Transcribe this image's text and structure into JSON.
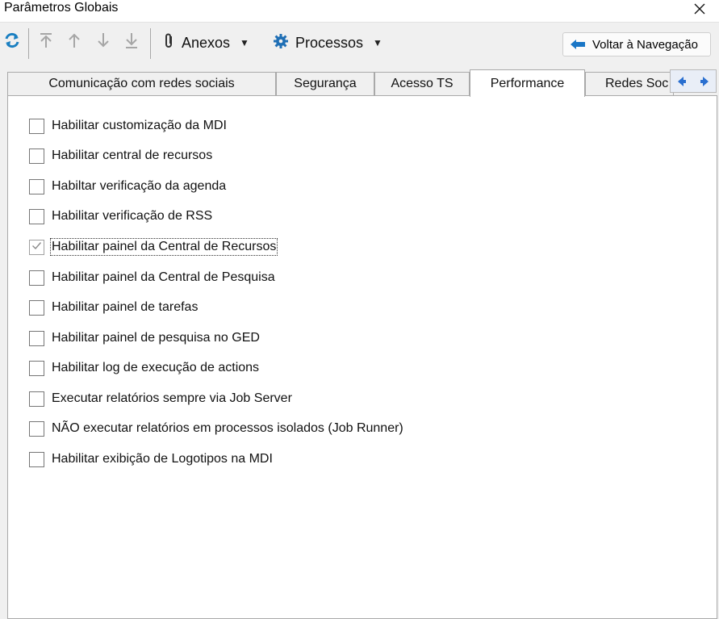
{
  "window": {
    "title": "Parâmetros Globais",
    "close_icon": "close-icon"
  },
  "toolbar": {
    "refresh_icon": "refresh-icon",
    "move_top_icon": "move-top-icon",
    "move_up_icon": "arrow-up-icon",
    "move_down_icon": "arrow-down-icon",
    "move_bottom_icon": "move-bottom-icon",
    "anexos": {
      "label": "Anexos",
      "icon": "paperclip-icon"
    },
    "processos": {
      "label": "Processos",
      "icon": "gear-icon"
    },
    "back_button": {
      "label": "Voltar à Navegação",
      "icon": "back-arrow-icon"
    }
  },
  "tabs": [
    {
      "label": "Comunicação com redes sociais",
      "active": false
    },
    {
      "label": "Segurança",
      "active": false
    },
    {
      "label": "Acesso TS",
      "active": false
    },
    {
      "label": "Performance",
      "active": true
    },
    {
      "label": "Redes Soc",
      "active": false
    }
  ],
  "tab_scroll": {
    "left_icon": "scroll-left-icon",
    "right_icon": "scroll-right-icon"
  },
  "options": [
    {
      "label": "Habilitar customização da MDI",
      "checked": false
    },
    {
      "label": "Habilitar central de recursos",
      "checked": false
    },
    {
      "label": "Habiltar verificação da agenda",
      "checked": false
    },
    {
      "label": "Habilitar verificação de RSS",
      "checked": false
    },
    {
      "label": "Habilitar painel da Central de Recursos",
      "checked": true,
      "focused": true
    },
    {
      "label": "Habilitar painel da Central de Pesquisa",
      "checked": false
    },
    {
      "label": "Habilitar painel de tarefas",
      "checked": false
    },
    {
      "label": "Habilitar painel de pesquisa no GED",
      "checked": false
    },
    {
      "label": "Habilitar log de execução de actions",
      "checked": false
    },
    {
      "label": "Executar relatórios sempre via Job Server",
      "checked": false
    },
    {
      "label": "NÃO executar relatórios em processos isolados (Job Runner)",
      "checked": false
    },
    {
      "label": "Habilitar exibição de Logotipos na MDI",
      "checked": false
    }
  ],
  "colors": {
    "refresh": "#1a7fc1",
    "gear": "#1f6fb5",
    "disabled_arrow": "#a6a6a6",
    "back_arrow": "#1a76c6"
  }
}
